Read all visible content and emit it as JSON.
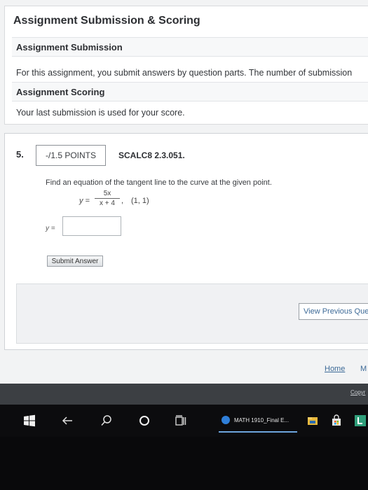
{
  "info": {
    "title": "Assignment Submission & Scoring",
    "submission_heading": "Assignment Submission",
    "submission_text": "For this assignment, you submit answers by question parts. The number of submission",
    "scoring_heading": "Assignment Scoring",
    "scoring_text": "Your last submission is used for your score."
  },
  "question": {
    "number": "5.",
    "points_label": "-/1.5 POINTS",
    "code": "SCALC8 2.3.051.",
    "prompt": "Find an equation of the tangent line to the curve at the given point.",
    "equation_lhs": "y =",
    "numerator": "5x",
    "denominator": "x + 4",
    "equation_comma": ",",
    "point": "(1, 1)",
    "answer_label": "y =",
    "answer_value": "",
    "submit_label": "Submit Answer",
    "prev_label": "View Previous Que"
  },
  "footer": {
    "home_label": "Home",
    "m_label": "M",
    "copyright_label": "Copyr"
  },
  "taskbar": {
    "app_label": "MATH 1910_Final E..."
  },
  "colors": {
    "link": "#3d6a97",
    "taskbar_accent": "#6da5dd"
  }
}
